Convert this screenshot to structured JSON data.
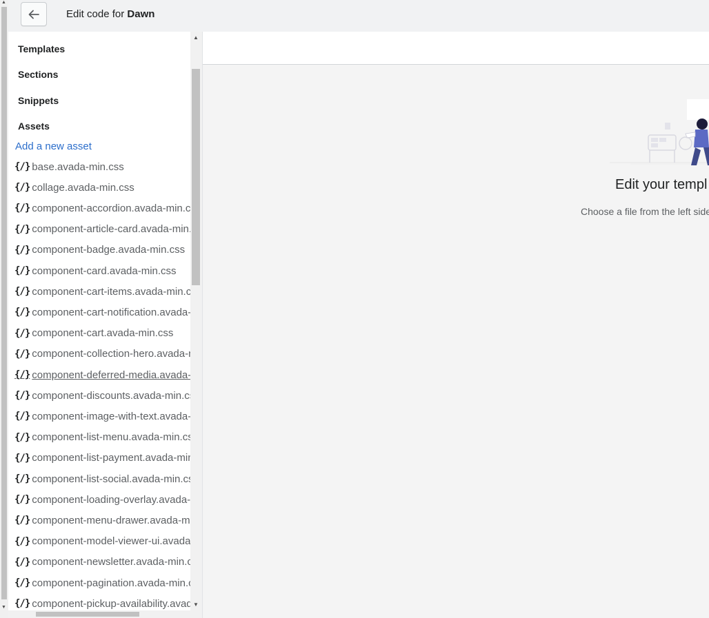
{
  "header": {
    "title_prefix": "Edit code for",
    "theme_name": "Dawn",
    "back_icon": "arrow-left-icon"
  },
  "sidebar": {
    "sections": [
      "Templates",
      "Sections",
      "Snippets",
      "Assets"
    ],
    "add_asset_label": "Add a new asset",
    "file_icon": "{/}",
    "files": [
      "base.avada-min.css",
      "collage.avada-min.css",
      "component-accordion.avada-min.css",
      "component-article-card.avada-min.css",
      "component-badge.avada-min.css",
      "component-card.avada-min.css",
      "component-cart-items.avada-min.css",
      "component-cart-notification.avada-min.css",
      "component-cart.avada-min.css",
      "component-collection-hero.avada-min.css",
      "component-deferred-media.avada-min.css",
      "component-discounts.avada-min.css",
      "component-image-with-text.avada-min.css",
      "component-list-menu.avada-min.css",
      "component-list-payment.avada-min.css",
      "component-list-social.avada-min.css",
      "component-loading-overlay.avada-min.css",
      "component-menu-drawer.avada-min.css",
      "component-model-viewer-ui.avada-min.css",
      "component-newsletter.avada-min.css",
      "component-pagination.avada-min.css",
      "component-pickup-availability.avada-min.css"
    ]
  },
  "main": {
    "empty_title": "Edit your templ",
    "empty_description": "Choose a file from the left side",
    "illustration": "person-at-desk-illustration"
  },
  "colors": {
    "link": "#2c6ecb",
    "illustration_accent": "#5c6ac4"
  }
}
